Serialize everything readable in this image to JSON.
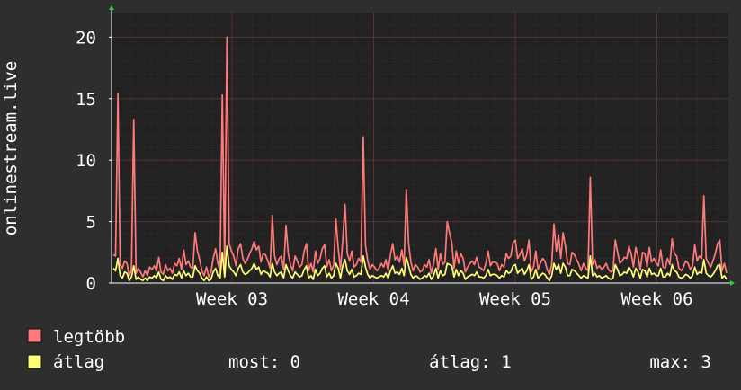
{
  "chart_data": {
    "type": "line",
    "title": "",
    "xlabel": "",
    "ylabel": "onlinestream.live",
    "ylim": [
      0,
      22
    ],
    "yticks": [
      0,
      5,
      10,
      15,
      20
    ],
    "x_ticks": [
      "Week 03",
      "Week 04",
      "Week 05",
      "Week 06"
    ],
    "grid": true,
    "legend": "bottom-left",
    "colors": {
      "background": "#2e2e2e",
      "plot_background": "#222222",
      "grid": "#5a3434",
      "axis": "#ffffff",
      "legtobb": "#ff7a7a",
      "atlag": "#ffff77"
    },
    "series": [
      {
        "name": "legtöbb",
        "color": "#ff7a7a",
        "values": [
          2.3,
          2.2,
          15.4,
          1.5,
          1.2,
          1.8,
          1.6,
          0.6,
          1.1,
          13.3,
          0.8,
          1.2,
          0.9,
          0.5,
          1.0,
          0.6,
          1.3,
          1.1,
          1.4,
          1.0,
          2.1,
          0.9,
          0.7,
          1.5,
          1.0,
          1.2,
          0.8,
          1.6,
          1.4,
          2.0,
          1.1,
          2.7,
          1.5,
          1.8,
          1.3,
          1.2,
          4.1,
          2.6,
          1.9,
          1.0,
          0.6,
          1.3,
          0.5,
          0.9,
          2.0,
          2.8,
          1.6,
          1.0,
          15.3,
          1.3,
          20.0,
          3.2,
          2.6,
          2.2,
          1.4,
          2.8,
          3.2,
          2.0,
          1.6,
          1.9,
          2.4,
          2.8,
          3.4,
          2.7,
          3.0,
          1.7,
          2.4,
          2.3,
          1.8,
          1.2,
          5.5,
          2.2,
          1.5,
          2.0,
          2.2,
          1.1,
          4.7,
          2.4,
          1.5,
          1.0,
          2.2,
          1.8,
          1.3,
          1.5,
          2.6,
          3.2,
          1.0,
          1.6,
          0.9,
          2.6,
          1.6,
          2.0,
          2.8,
          3.1,
          1.3,
          1.9,
          1.0,
          1.5,
          5.2,
          2.8,
          1.1,
          3.5,
          6.4,
          2.4,
          1.8,
          2.6,
          1.3,
          1.5,
          2.0,
          1.7,
          11.9,
          3.1,
          1.8,
          1.1,
          1.5,
          1.3,
          1.0,
          1.2,
          1.6,
          1.3,
          1.9,
          1.0,
          2.3,
          3.2,
          1.9,
          2.2,
          1.7,
          2.7,
          1.4,
          7.6,
          3.2,
          1.7,
          1.0,
          1.5,
          1.3,
          0.9,
          1.0,
          1.5,
          1.3,
          1.9,
          0.8,
          1.6,
          2.8,
          1.1,
          2.4,
          1.5,
          1.7,
          5.0,
          4.1,
          3.3,
          1.2,
          2.6,
          1.6,
          2.4,
          2.0,
          0.9,
          1.3,
          1.6,
          1.8,
          1.5,
          2.1,
          1.3,
          1.2,
          1.0,
          1.6,
          2.6,
          1.4,
          1.7,
          1.7,
          1.6,
          1.0,
          1.5,
          1.3,
          2.4,
          2.0,
          2.2,
          3.3,
          3.5,
          2.0,
          2.3,
          2.8,
          1.8,
          2.3,
          3.5,
          0.9,
          1.3,
          2.6,
          1.1,
          1.6,
          2.0,
          1.8,
          1.1,
          0.7,
          1.5,
          4.8,
          2.6,
          3.9,
          2.0,
          4.1,
          3.0,
          1.6,
          1.5,
          2.5,
          2.3,
          1.9,
          1.5,
          1.0,
          1.6,
          1.2,
          1.0,
          8.6,
          1.5,
          1.9,
          1.2,
          1.4,
          1.1,
          1.3,
          1.6,
          1.1,
          0.9,
          1.0,
          3.5,
          2.5,
          1.6,
          1.8,
          2.1,
          2.0,
          3.0,
          2.4,
          1.3,
          2.9,
          2.2,
          1.1,
          2.5,
          2.4,
          1.3,
          2.9,
          1.7,
          2.0,
          1.6,
          1.4,
          2.7,
          1.3,
          1.2,
          2.0,
          1.5,
          3.6,
          2.4,
          2.2,
          1.2,
          1.0,
          1.3,
          1.8,
          1.6,
          1.1,
          1.4,
          3.1,
          1.8,
          2.2,
          2.0,
          7.1,
          2.0,
          1.6,
          1.3,
          1.8,
          2.4,
          3.2,
          3.5,
          1.0,
          1.6,
          0.8
        ]
      },
      {
        "name": "átlag",
        "color": "#ffff77",
        "values": [
          1.2,
          1.0,
          2.0,
          0.6,
          0.4,
          0.9,
          0.8,
          0.2,
          0.5,
          1.4,
          0.3,
          0.5,
          0.3,
          0.2,
          0.4,
          0.2,
          0.5,
          0.4,
          0.6,
          0.4,
          0.9,
          0.3,
          0.2,
          0.6,
          0.4,
          0.5,
          0.3,
          0.7,
          0.6,
          0.9,
          0.4,
          1.0,
          0.6,
          0.8,
          0.5,
          0.5,
          1.4,
          1.0,
          0.8,
          0.4,
          0.2,
          0.5,
          0.2,
          0.3,
          0.9,
          1.2,
          0.6,
          0.4,
          2.5,
          0.5,
          3.0,
          1.4,
          1.1,
          0.9,
          0.6,
          1.2,
          1.5,
          0.9,
          0.7,
          0.8,
          1.0,
          1.2,
          1.6,
          1.1,
          1.3,
          0.7,
          1.0,
          0.9,
          0.8,
          0.5,
          1.6,
          0.9,
          0.6,
          0.8,
          0.9,
          0.4,
          1.5,
          1.0,
          0.6,
          0.4,
          0.9,
          0.7,
          0.5,
          0.6,
          1.1,
          1.4,
          0.4,
          0.6,
          0.3,
          1.1,
          0.6,
          0.8,
          1.2,
          1.4,
          0.5,
          0.8,
          0.4,
          0.6,
          1.6,
          1.2,
          0.4,
          1.4,
          1.9,
          1.0,
          0.7,
          1.1,
          0.5,
          0.6,
          0.8,
          0.7,
          2.2,
          1.3,
          0.7,
          0.4,
          0.6,
          0.5,
          0.4,
          0.5,
          0.6,
          0.5,
          0.8,
          0.4,
          1.0,
          1.4,
          0.8,
          0.9,
          0.7,
          1.2,
          0.6,
          2.1,
          1.4,
          0.7,
          0.4,
          0.6,
          0.5,
          0.3,
          0.4,
          0.6,
          0.5,
          0.8,
          0.3,
          0.6,
          1.2,
          0.4,
          1.0,
          0.6,
          0.7,
          1.6,
          1.5,
          1.4,
          0.5,
          1.1,
          0.6,
          1.0,
          0.8,
          0.3,
          0.5,
          0.6,
          0.7,
          0.6,
          0.9,
          0.5,
          0.5,
          0.4,
          0.6,
          1.1,
          0.6,
          0.7,
          0.7,
          0.6,
          0.4,
          0.6,
          0.5,
          1.0,
          0.8,
          0.9,
          1.4,
          1.5,
          0.8,
          1.0,
          1.2,
          0.7,
          1.0,
          1.5,
          0.3,
          0.5,
          1.1,
          0.4,
          0.6,
          0.8,
          0.7,
          0.4,
          0.2,
          0.6,
          1.6,
          1.1,
          1.5,
          0.8,
          1.6,
          1.3,
          0.6,
          0.6,
          1.1,
          1.0,
          0.8,
          0.6,
          0.4,
          0.6,
          0.5,
          0.4,
          2.2,
          0.6,
          0.8,
          0.5,
          0.6,
          0.4,
          0.5,
          0.6,
          0.4,
          0.3,
          0.4,
          1.5,
          1.1,
          0.6,
          0.7,
          0.9,
          0.8,
          1.3,
          1.0,
          0.5,
          1.2,
          0.9,
          0.4,
          1.1,
          1.0,
          0.5,
          1.2,
          0.7,
          0.8,
          0.6,
          0.6,
          1.2,
          0.5,
          0.5,
          0.8,
          0.6,
          1.5,
          1.0,
          0.9,
          0.5,
          0.4,
          0.5,
          0.7,
          0.6,
          0.4,
          0.6,
          1.3,
          0.7,
          0.9,
          0.8,
          1.9,
          0.8,
          0.6,
          0.5,
          0.7,
          1.0,
          1.4,
          1.5,
          0.4,
          0.6,
          0.3
        ]
      }
    ]
  },
  "legend": {
    "items": [
      {
        "label": "legtöbb",
        "color": "#ff7a7a"
      },
      {
        "label": "átlag",
        "color": "#ffff77"
      }
    ],
    "stats": {
      "most": "most: 0",
      "atlag": "átlag: 1",
      "max": "max: 3"
    }
  }
}
